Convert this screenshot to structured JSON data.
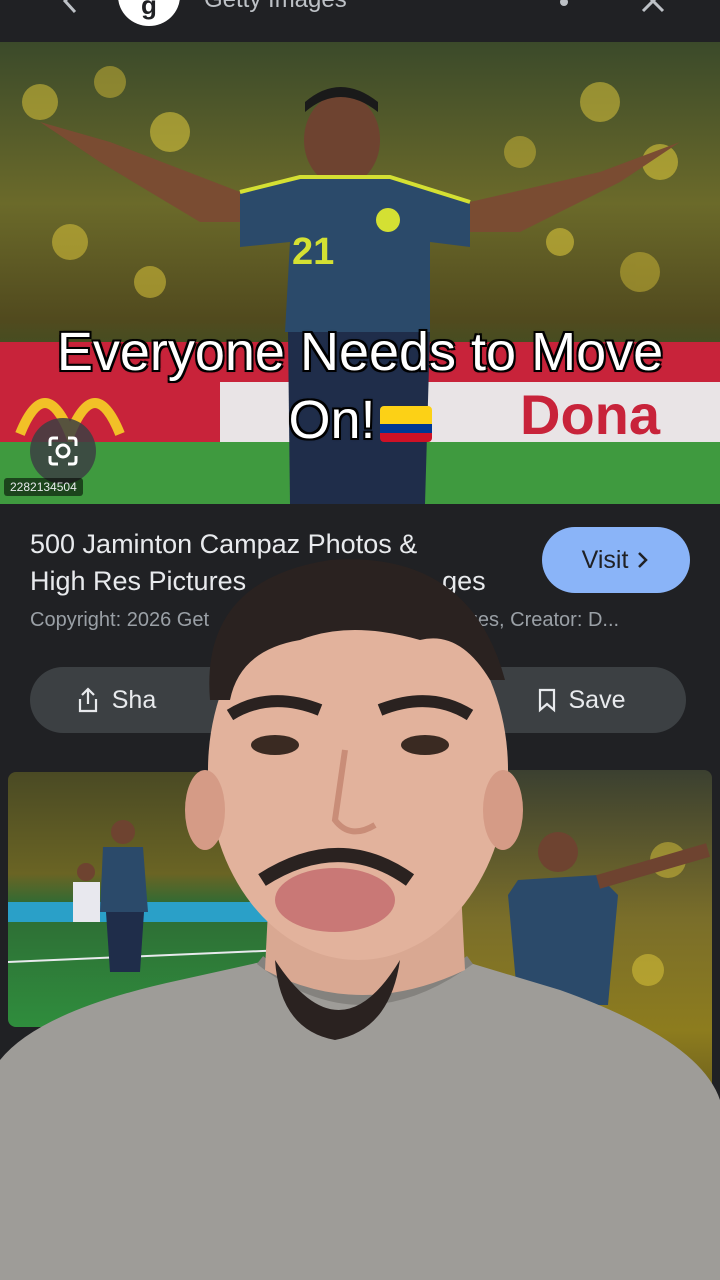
{
  "top_bar": {
    "site_name": "Getty Images",
    "logo_letter": "g",
    "icons": [
      "back-arrow-icon",
      "more-vert-icon",
      "close-icon"
    ]
  },
  "hero": {
    "image_id": "2282134504",
    "jersey_number": "21",
    "lens_icon": "google-lens-icon"
  },
  "caption": {
    "line1": "Everyone Needs to Move",
    "line2": "On!",
    "emoji": "colombia-flag"
  },
  "result": {
    "title": "500 Jaminton Campaz Photos & High Res Pictures - Getty Images",
    "title_visible_line1": "500 Jaminton Campaz Photos &",
    "title_visible_line2": "High Res Pictures",
    "title_visible_line2_tail": "ges",
    "copyright": "Copyright: 2026 Get",
    "copyright_tail": "mages, Creator: D...",
    "visit_label": "Visit",
    "share_label": "Sha",
    "save_label": "Save"
  },
  "colors": {
    "background": "#202124",
    "accent": "#8ab4f8",
    "button_bg": "#3c4043",
    "jersey": "#2b4a6a",
    "jersey_trim": "#d4e033"
  }
}
